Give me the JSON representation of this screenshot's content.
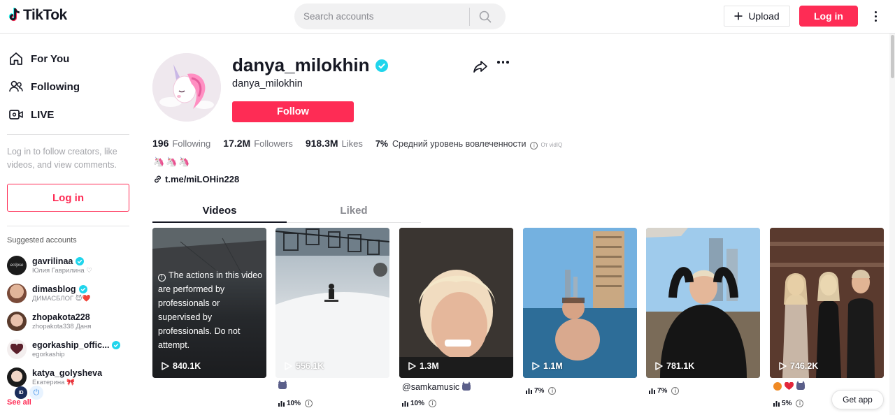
{
  "header": {
    "logo_text": "TikTok",
    "search_placeholder": "Search accounts",
    "upload_label": "Upload",
    "login_label": "Log in"
  },
  "sidebar": {
    "nav": [
      {
        "label": "For You",
        "icon": "home-icon"
      },
      {
        "label": "Following",
        "icon": "following-icon"
      },
      {
        "label": "LIVE",
        "icon": "live-icon"
      }
    ],
    "login_prompt": "Log in to follow creators, like videos, and view comments.",
    "login_label": "Log in",
    "suggested_title": "Suggested accounts",
    "accounts": [
      {
        "name": "gavrilinaa",
        "sub": "Юлия Гаврилина ♡",
        "verified": true
      },
      {
        "name": "dimasblog",
        "sub": "ДИМАСБЛОГ 😈❤️",
        "verified": true
      },
      {
        "name": "zhopakota228",
        "sub": "zhopakota338 Даня",
        "verified": false
      },
      {
        "name": "egorkaship_offic...",
        "sub": "egorkaship",
        "verified": true
      },
      {
        "name": "katya_golysheva",
        "sub": "Екатерина 🎀",
        "verified": false
      }
    ],
    "see_all": "See all"
  },
  "profile": {
    "username": "danya_milokhin",
    "nickname": "danya_milokhin",
    "follow_label": "Follow",
    "following_count": "196",
    "following_label": "Following",
    "followers_count": "17.2M",
    "followers_label": "Followers",
    "likes_count": "918.3M",
    "likes_label": "Likes",
    "engagement_value": "7%",
    "engagement_label": "Средний уровень вовлеченности",
    "engagement_source": "От vidIQ",
    "bio": "🦄🦄🦄",
    "link": "t.me/miLOHin228"
  },
  "tabs": [
    {
      "label": "Videos",
      "active": true
    },
    {
      "label": "Liked",
      "active": false
    }
  ],
  "videos": [
    {
      "views": "840.1K",
      "notice": "The actions in this video are performed by professionals or supervised by professionals. Do not attempt.",
      "caption": "",
      "engagement": ""
    },
    {
      "views": "556.1K",
      "caption": "",
      "engagement": "10%"
    },
    {
      "views": "1.3M",
      "caption": "@samkamusic",
      "engagement": "10%"
    },
    {
      "views": "1.1M",
      "caption": "",
      "engagement": "7%"
    },
    {
      "views": "781.1K",
      "caption": "",
      "engagement": "7%"
    },
    {
      "views": "746.2K",
      "caption": "",
      "engagement": "5%"
    }
  ],
  "get_app_label": "Get app",
  "colors": {
    "brand": "#fe2c55",
    "verified": "#20d5ec",
    "text": "#161823"
  }
}
